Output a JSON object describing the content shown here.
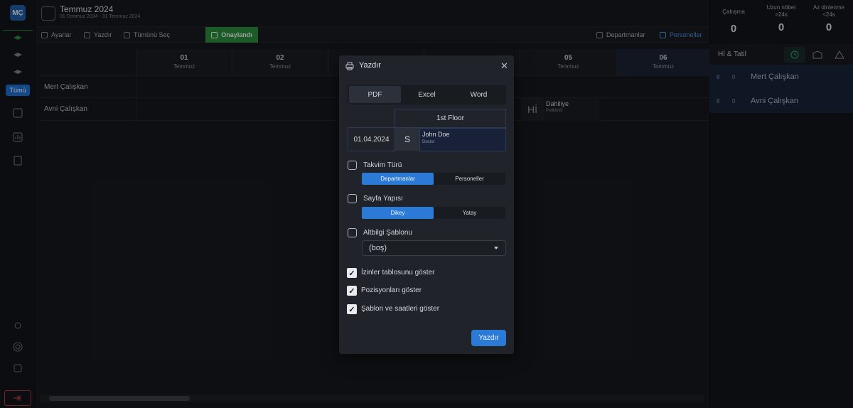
{
  "user": {
    "initials": "MÇ"
  },
  "sidebar": {
    "filter_label": "Tümü"
  },
  "header": {
    "title": "Temmuz 2024",
    "range": "01 Temmuz 2024 - 31 Temmuz 2024"
  },
  "toolbar": {
    "settings": "Ayarlar",
    "print": "Yazdır",
    "select_all": "Tümünü Seç",
    "approved": "Onaylandı",
    "departments": "Departmanlar",
    "staff": "Personeller"
  },
  "columns": [
    {
      "day": "01",
      "month": "Temmuz"
    },
    {
      "day": "02",
      "month": "Temmuz"
    },
    {
      "day": "05",
      "month": "Temmuz"
    },
    {
      "day": "06",
      "month": "Temmuz"
    }
  ],
  "rows": [
    "Mert Çalışkan",
    "Avni Çalışkan"
  ],
  "shift": {
    "code": "Hİ",
    "dept": "Dahiliye",
    "unit": "Poliklinik"
  },
  "stats": [
    {
      "label": "Çakışma",
      "value": "0"
    },
    {
      "label": "Uzun nöbet\n>24s",
      "value": "0"
    },
    {
      "label": "Az dinlenme\n<24s",
      "value": "0"
    }
  ],
  "right_panel": {
    "title": "Hİ & Tatil",
    "people": [
      {
        "a": "8",
        "b": "0",
        "name": "Mert Çalışkan"
      },
      {
        "a": "8",
        "b": "0",
        "name": "Avni Çalışkan"
      }
    ]
  },
  "modal": {
    "title": "Yazdır",
    "formats": [
      "PDF",
      "Excel",
      "Word"
    ],
    "selected_format": "PDF",
    "preview": {
      "floor": "1st Floor",
      "date": "01.04.2024",
      "letter": "S",
      "name": "John Doe",
      "role": "Doctor"
    },
    "calendar_type": {
      "label": "Takvim Türü",
      "options": [
        "Departmanlar",
        "Personeller"
      ],
      "selected": "Departmanlar"
    },
    "page_layout": {
      "label": "Sayfa Yapısı",
      "options": [
        "Dikey",
        "Yatay"
      ],
      "selected": "Dikey"
    },
    "footer_template": {
      "label": "Altbilgi Şablonu",
      "value": "(boş)"
    },
    "checkboxes": [
      {
        "label": "İzinler tablosunu göster",
        "checked": true
      },
      {
        "label": "Pozisyonları göster",
        "checked": true
      },
      {
        "label": "Şablon ve saatleri göster",
        "checked": true
      }
    ],
    "print_button": "Yazdır"
  }
}
